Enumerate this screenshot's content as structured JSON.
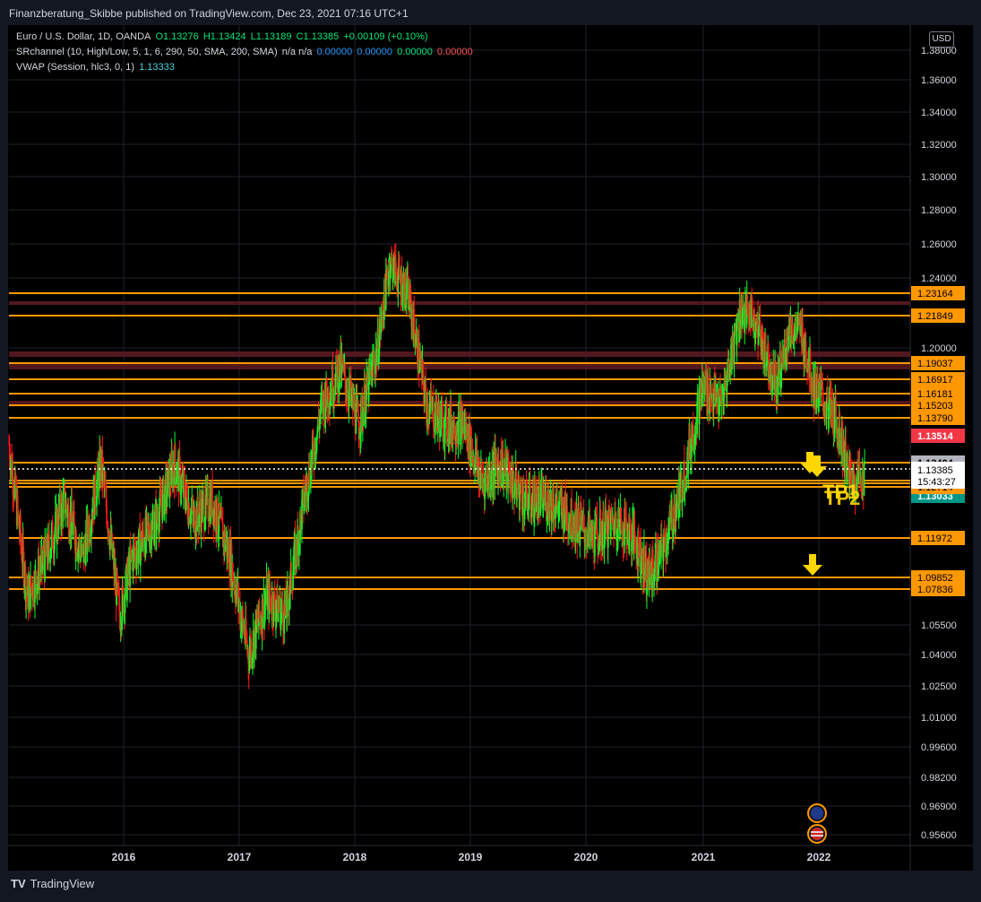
{
  "header": {
    "publisher": "Finanzberatung_Skibbe published on TradingView.com, Dec 23, 2021 07:16 UTC+1"
  },
  "legend": {
    "symbol": "Euro / U.S. Dollar, 1D, OANDA",
    "open": "O1.13276",
    "high": "H1.13424",
    "low": "L1.13189",
    "close": "C1.13385",
    "change": "+0.00109 (+0.10%)",
    "indicator1": "SRchannel (10, High/Low, 5, 1, 6, 290, 50, SMA, 200, SMA)",
    "indicator1_na": "n/a n/a",
    "indicator1_values": [
      "0.00000",
      "0.00000",
      "0.00000",
      "0.00000"
    ],
    "indicator2": "VWAP (Session, hlc3, 0, 1)",
    "indicator2_value": "1.13333"
  },
  "currency": "USD",
  "footer": {
    "brand": "TradingView"
  },
  "colors": {
    "up": "#26a69a",
    "bull": "#00ff2a",
    "bear": "#ff1a1a",
    "level": "#ff9800",
    "annotation": "#ffd600"
  },
  "chart_data": {
    "type": "candlestick",
    "symbol": "EURUSD",
    "x_labels": [
      "2016",
      "2017",
      "2018",
      "2019",
      "2020",
      "2021",
      "2022"
    ],
    "x_range": [
      2015.0,
      2022.33
    ],
    "y_labels": [
      1.38,
      1.36,
      1.34,
      1.32,
      1.3,
      1.28,
      1.26,
      1.24,
      1.2,
      1.04,
      1.055,
      1.025,
      1.01,
      0.996,
      0.982,
      0.969,
      0.956
    ],
    "y_tick_text": [
      "1.38000",
      "1.36000",
      "1.34000",
      "1.32000",
      "1.30000",
      "1.28000",
      "1.26000",
      "1.24000",
      "1.20000",
      "1.04000",
      "1.05500",
      "1.02500",
      "1.01000",
      "0.99600",
      "0.98200",
      "0.96900",
      "0.95600"
    ],
    "support_resistance_levels": [
      1.23164,
      1.21849,
      1.19037,
      1.16917,
      1.16181,
      1.15203,
      1.1379,
      1.13514,
      1.13404,
      1.13033,
      1.13012,
      1.12849,
      1.12714,
      1.11972,
      1.09852,
      1.07836
    ],
    "level_labels": [
      "1.23164",
      "1.21849",
      "1.19037",
      "1.16917",
      "1.16181",
      "1.15203",
      "1.13790",
      "1.13514",
      "1.13404",
      "1.13033",
      "1.13012",
      "1.12849",
      "1.12714",
      "1.11972",
      "1.09852",
      "1.07836"
    ],
    "current_price": "1.13385",
    "countdown": "15:43:27",
    "price_path": [
      [
        2015.0,
        1.15
      ],
      [
        2015.15,
        1.07
      ],
      [
        2015.3,
        1.09
      ],
      [
        2015.45,
        1.12
      ],
      [
        2015.6,
        1.09
      ],
      [
        2015.75,
        1.14
      ],
      [
        2015.9,
        1.06
      ],
      [
        2016.0,
        1.09
      ],
      [
        2016.2,
        1.11
      ],
      [
        2016.35,
        1.14
      ],
      [
        2016.5,
        1.11
      ],
      [
        2016.65,
        1.12
      ],
      [
        2016.8,
        1.09
      ],
      [
        2016.95,
        1.04
      ],
      [
        2017.1,
        1.07
      ],
      [
        2017.25,
        1.06
      ],
      [
        2017.4,
        1.12
      ],
      [
        2017.55,
        1.17
      ],
      [
        2017.7,
        1.19
      ],
      [
        2017.85,
        1.16
      ],
      [
        2018.0,
        1.2
      ],
      [
        2018.1,
        1.25
      ],
      [
        2018.25,
        1.23
      ],
      [
        2018.4,
        1.17
      ],
      [
        2018.55,
        1.16
      ],
      [
        2018.7,
        1.16
      ],
      [
        2018.85,
        1.13
      ],
      [
        2019.0,
        1.14
      ],
      [
        2019.2,
        1.12
      ],
      [
        2019.4,
        1.12
      ],
      [
        2019.6,
        1.11
      ],
      [
        2019.75,
        1.1
      ],
      [
        2019.95,
        1.11
      ],
      [
        2020.1,
        1.1
      ],
      [
        2020.2,
        1.08
      ],
      [
        2020.3,
        1.09
      ],
      [
        2020.45,
        1.12
      ],
      [
        2020.55,
        1.15
      ],
      [
        2020.65,
        1.18
      ],
      [
        2020.8,
        1.17
      ],
      [
        2020.95,
        1.22
      ],
      [
        2021.05,
        1.22
      ],
      [
        2021.15,
        1.2
      ],
      [
        2021.25,
        1.18
      ],
      [
        2021.35,
        1.21
      ],
      [
        2021.45,
        1.21
      ],
      [
        2021.55,
        1.18
      ],
      [
        2021.65,
        1.17
      ],
      [
        2021.75,
        1.16
      ],
      [
        2021.85,
        1.13
      ],
      [
        2021.95,
        1.133
      ]
    ],
    "annotations": [
      {
        "text": "TP1",
        "style": "arrow-down"
      },
      {
        "text": "TP2",
        "style": "arrow-down"
      }
    ]
  }
}
